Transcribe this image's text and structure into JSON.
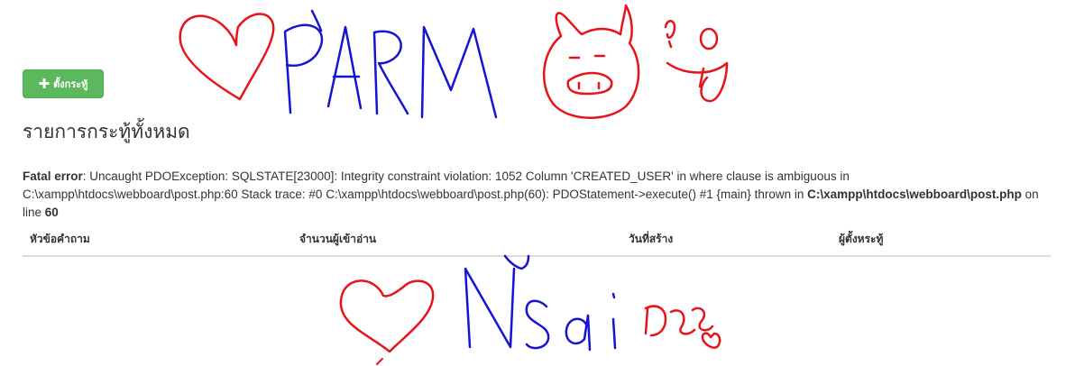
{
  "toolbar": {
    "post_button_label": "ตั้งกระทู้"
  },
  "page_title": "รายการกระทู้ทั้งหมด",
  "error": {
    "label": "Fatal error",
    "message": ": Uncaught PDOException: SQLSTATE[23000]: Integrity constraint violation: 1052 Column 'CREATED_USER' in where clause is ambiguous in C:\\xampp\\htdocs\\webboard\\post.php:60 Stack trace: #0 C:\\xampp\\htdocs\\webboard\\post.php(60): PDOStatement->execute() #1 {main} thrown in ",
    "file": "C:\\xampp\\htdocs\\webboard\\post.php",
    "line_text": " on line ",
    "line": "60"
  },
  "table": {
    "headers": [
      "หัวข้อคำถาม",
      "จำนวนผู้เข้าอ่าน",
      "วันที่สร้าง",
      "ผู้ตั้งหระทู้"
    ]
  },
  "doodle_colors": {
    "red": "#e8131a",
    "blue": "#1414d4"
  }
}
